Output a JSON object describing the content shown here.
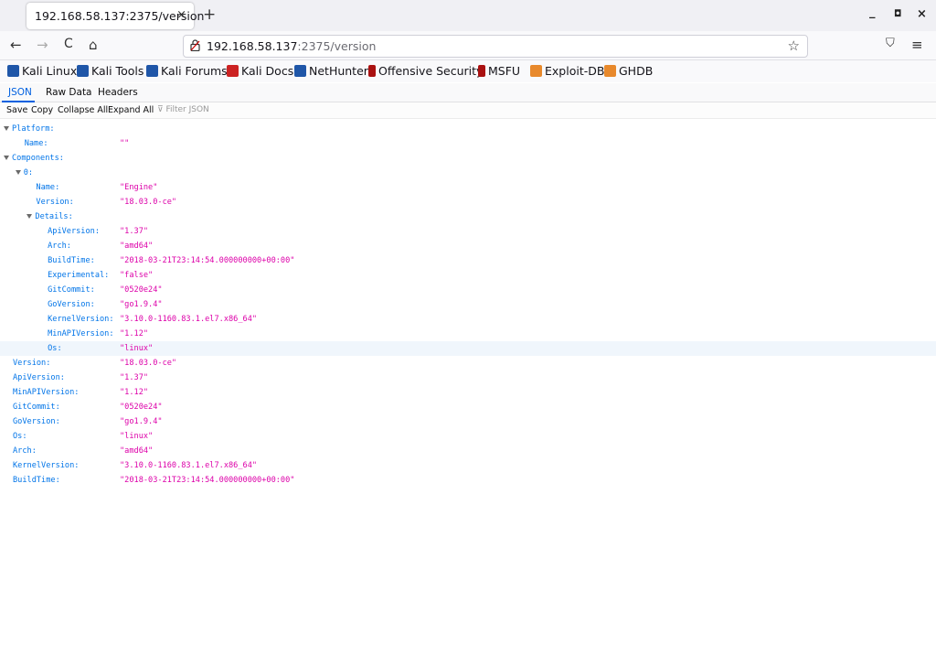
{
  "browser": {
    "tab_title": "192.168.58.137:2375/version",
    "tab_close": "×",
    "new_tab": "+",
    "window_controls": {
      "minimize": "_",
      "maximize": "◘",
      "close": "×"
    },
    "nav": {
      "back": "←",
      "forward": "→",
      "reload": "C",
      "home": "⌂"
    },
    "url": {
      "host": "192.168.58.137",
      "path": ":2375/version"
    },
    "bookmark_star": "☆",
    "pocket": "⛉",
    "menu": "≡",
    "bookmarks": [
      {
        "label": "Kali Linux",
        "icon": "kali-dragon-icon",
        "color": "#1f56a8"
      },
      {
        "label": "Kali Tools",
        "icon": "kali-dragon-icon",
        "color": "#1f56a8"
      },
      {
        "label": "Kali Forums",
        "icon": "kali-dragon-icon",
        "color": "#1f56a8"
      },
      {
        "label": "Kali Docs",
        "icon": "docs-icon",
        "color": "#cc2222"
      },
      {
        "label": "NetHunter",
        "icon": "kali-dragon-icon",
        "color": "#1f56a8"
      },
      {
        "label": "Offensive Security",
        "icon": "offsec-icon",
        "color": "#aa1111"
      },
      {
        "label": "MSFU",
        "icon": "offsec-icon",
        "color": "#aa1111"
      },
      {
        "label": "Exploit-DB",
        "icon": "exploitdb-icon",
        "color": "#e8892c"
      },
      {
        "label": "GHDB",
        "icon": "exploitdb-icon",
        "color": "#e8892c"
      }
    ]
  },
  "viewer": {
    "tabs": [
      "JSON",
      "Raw Data",
      "Headers"
    ],
    "toolbar": {
      "save": "Save",
      "copy": "Copy",
      "collapse_all": "Collapse All",
      "expand_all": "Expand All",
      "filter_placeholder": "Filter JSON"
    },
    "rows": [
      {
        "key": "Platform:",
        "value": "",
        "depth": 0,
        "expandable": true
      },
      {
        "key": "Name:",
        "value": "\"\"",
        "depth": 1,
        "expandable": false
      },
      {
        "key": "Components:",
        "value": "",
        "depth": 0,
        "expandable": true
      },
      {
        "key": "0:",
        "value": "",
        "depth": 1,
        "expandable": true
      },
      {
        "key": "Name:",
        "value": "\"Engine\"",
        "depth": 2,
        "expandable": false
      },
      {
        "key": "Version:",
        "value": "\"18.03.0-ce\"",
        "depth": 2,
        "expandable": false
      },
      {
        "key": "Details:",
        "value": "",
        "depth": 2,
        "expandable": true
      },
      {
        "key": "ApiVersion:",
        "value": "\"1.37\"",
        "depth": 3,
        "expandable": false
      },
      {
        "key": "Arch:",
        "value": "\"amd64\"",
        "depth": 3,
        "expandable": false
      },
      {
        "key": "BuildTime:",
        "value": "\"2018-03-21T23:14:54.000000000+00:00\"",
        "depth": 3,
        "expandable": false
      },
      {
        "key": "Experimental:",
        "value": "\"false\"",
        "depth": 3,
        "expandable": false
      },
      {
        "key": "GitCommit:",
        "value": "\"0520e24\"",
        "depth": 3,
        "expandable": false
      },
      {
        "key": "GoVersion:",
        "value": "\"go1.9.4\"",
        "depth": 3,
        "expandable": false
      },
      {
        "key": "KernelVersion:",
        "value": "\"3.10.0-1160.83.1.el7.x86_64\"",
        "depth": 3,
        "expandable": false
      },
      {
        "key": "MinAPIVersion:",
        "value": "\"1.12\"",
        "depth": 3,
        "expandable": false
      },
      {
        "key": "Os:",
        "value": "\"linux\"",
        "depth": 3,
        "expandable": false,
        "highlighted": true
      },
      {
        "key": "Version:",
        "value": "\"18.03.0-ce\"",
        "depth": 0,
        "expandable": false
      },
      {
        "key": "ApiVersion:",
        "value": "\"1.37\"",
        "depth": 0,
        "expandable": false
      },
      {
        "key": "MinAPIVersion:",
        "value": "\"1.12\"",
        "depth": 0,
        "expandable": false
      },
      {
        "key": "GitCommit:",
        "value": "\"0520e24\"",
        "depth": 0,
        "expandable": false
      },
      {
        "key": "GoVersion:",
        "value": "\"go1.9.4\"",
        "depth": 0,
        "expandable": false
      },
      {
        "key": "Os:",
        "value": "\"linux\"",
        "depth": 0,
        "expandable": false
      },
      {
        "key": "Arch:",
        "value": "\"amd64\"",
        "depth": 0,
        "expandable": false
      },
      {
        "key": "KernelVersion:",
        "value": "\"3.10.0-1160.83.1.el7.x86_64\"",
        "depth": 0,
        "expandable": false
      },
      {
        "key": "BuildTime:",
        "value": "\"2018-03-21T23:14:54.000000000+00:00\"",
        "depth": 0,
        "expandable": false
      }
    ]
  }
}
